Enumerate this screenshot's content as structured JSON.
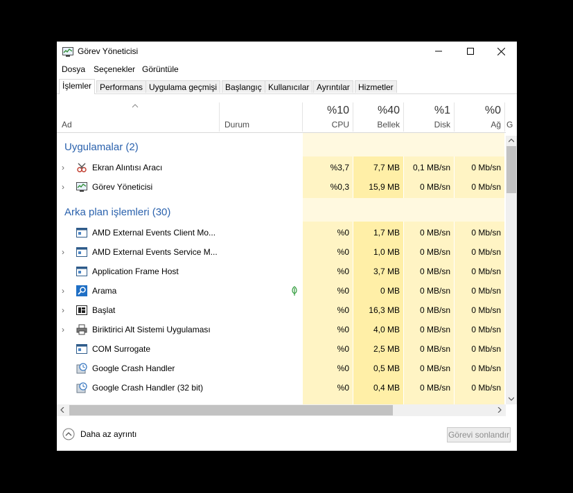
{
  "window": {
    "title": "Görev Yöneticisi"
  },
  "menu": [
    "Dosya",
    "Seçenekler",
    "Görüntüle"
  ],
  "tabs": [
    "İşlemler",
    "Performans",
    "Uygulama geçmişi",
    "Başlangıç",
    "Kullanıcılar",
    "Ayrıntılar",
    "Hizmetler"
  ],
  "columns": {
    "name": "Ad",
    "status": "Durum",
    "cpu": {
      "pct": "%10",
      "label": "CPU"
    },
    "memory": {
      "pct": "%40",
      "label": "Bellek"
    },
    "disk": {
      "pct": "%1",
      "label": "Disk"
    },
    "network": {
      "pct": "%0",
      "label": "Ağ"
    },
    "extra": "G"
  },
  "groups": {
    "apps": "Uygulamalar (2)",
    "background": "Arka plan işlemleri (30)"
  },
  "rows": [
    {
      "name": "Ekran Alıntısı Aracı",
      "cpu": "%3,7",
      "mem": "7,7 MB",
      "disk": "0,1 MB/sn",
      "net": "0 Mb/sn",
      "icon": "snipping-tool-icon"
    },
    {
      "name": "Görev Yöneticisi",
      "cpu": "%0,3",
      "mem": "15,9 MB",
      "disk": "0 MB/sn",
      "net": "0 Mb/sn",
      "icon": "task-manager-icon"
    },
    {
      "name": "AMD External Events Client Mo...",
      "cpu": "%0",
      "mem": "1,7 MB",
      "disk": "0 MB/sn",
      "net": "0 Mb/sn",
      "icon": "service-window-icon"
    },
    {
      "name": "AMD External Events Service M...",
      "cpu": "%0",
      "mem": "1,0 MB",
      "disk": "0 MB/sn",
      "net": "0 Mb/sn",
      "icon": "service-window-icon"
    },
    {
      "name": "Application Frame Host",
      "cpu": "%0",
      "mem": "3,7 MB",
      "disk": "0 MB/sn",
      "net": "0 Mb/sn",
      "icon": "service-window-icon"
    },
    {
      "name": "Arama",
      "cpu": "%0",
      "mem": "0 MB",
      "disk": "0 MB/sn",
      "net": "0 Mb/sn",
      "icon": "search-icon"
    },
    {
      "name": "Başlat",
      "cpu": "%0",
      "mem": "16,3 MB",
      "disk": "0 MB/sn",
      "net": "0 Mb/sn",
      "icon": "start-icon"
    },
    {
      "name": "Biriktirici Alt Sistemi Uygulaması",
      "cpu": "%0",
      "mem": "4,0 MB",
      "disk": "0 MB/sn",
      "net": "0 Mb/sn",
      "icon": "printer-icon"
    },
    {
      "name": "COM Surrogate",
      "cpu": "%0",
      "mem": "2,5 MB",
      "disk": "0 MB/sn",
      "net": "0 Mb/sn",
      "icon": "service-window-icon"
    },
    {
      "name": "Google Crash Handler",
      "cpu": "%0",
      "mem": "0,5 MB",
      "disk": "0 MB/sn",
      "net": "0 Mb/sn",
      "icon": "google-update-icon"
    },
    {
      "name": "Google Crash Handler (32 bit)",
      "cpu": "%0",
      "mem": "0,4 MB",
      "disk": "0 MB/sn",
      "net": "0 Mb/sn",
      "icon": "google-update-icon"
    }
  ],
  "footer": {
    "less_details": "Daha az ayrıntı",
    "end_task": "Görevi sonlandır"
  },
  "colors": {
    "group_title": "#2b62ad",
    "heat_light": "#fff4c4",
    "heat_mid": "#ffefa7",
    "heat_strong": "#ffe799"
  }
}
